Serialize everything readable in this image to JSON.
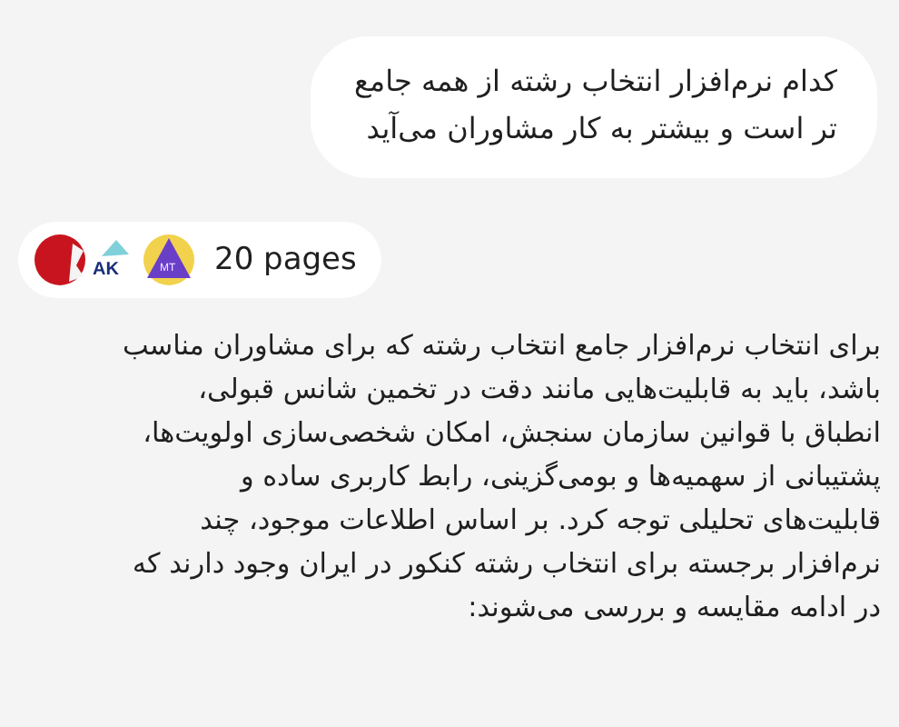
{
  "question": {
    "text": "کدام نرم‌افزار انتخاب رشته از همه جامع\nتر است و بیشتر به کار مشاوران می‌آید"
  },
  "sources": {
    "logos": [
      {
        "kind": "triangle",
        "label": "MT"
      },
      {
        "kind": "letters",
        "label": "AK"
      },
      {
        "kind": "circle",
        "color": "#c8141e"
      }
    ],
    "count": "20 pages"
  },
  "answer": {
    "text": "برای انتخاب نرم‌افزار جامع انتخاب رشته که برای مشاوران مناسب\nباشد، باید به قابلیت‌هایی مانند دقت در تخمین شانس قبولی،\nانطباق با قوانین سازمان سنجش، امکان شخصی‌سازی اولویت‌ها،\nپشتیبانی از سهمیه‌ها و بومی‌گزینی، رابط کاربری ساده و\nقابلیت‌های تحلیلی توجه کرد. بر اساس اطلاعات موجود، چند\nنرم‌افزار برجسته برای انتخاب رشته کنکور در ایران وجود دارند که\nدر ادامه مقایسه و بررسی می‌شوند:"
  }
}
